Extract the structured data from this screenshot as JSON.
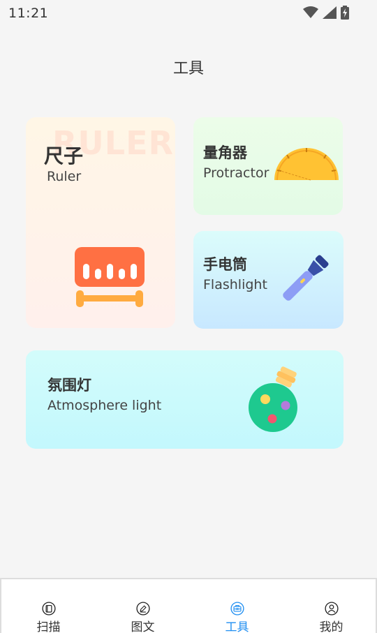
{
  "status_bar": {
    "time": "11:21",
    "icons": [
      "wifi-icon",
      "signal-icon",
      "battery-charging-icon"
    ]
  },
  "header": {
    "title": "工具"
  },
  "tools": {
    "ruler": {
      "title": "尺子",
      "subtitle": "Ruler",
      "watermark": "RULER"
    },
    "protractor": {
      "title": "量角器",
      "subtitle": "Protractor"
    },
    "flashlight": {
      "title": "手电筒",
      "subtitle": "Flashlight"
    },
    "atmosphere": {
      "title": "氛围灯",
      "subtitle": "Atmosphere light"
    }
  },
  "tab_bar": {
    "active": "tools",
    "tabs": [
      {
        "label": "扫描",
        "icon": "scan-icon"
      },
      {
        "label": "图文",
        "icon": "edit-icon"
      },
      {
        "label": "工具",
        "icon": "toolbox-icon"
      },
      {
        "label": "我的",
        "icon": "profile-icon"
      }
    ]
  },
  "colors": {
    "accent": "#1f8ef1",
    "ruler_orange": "#ff7043",
    "ruler_bar": "#ffab40",
    "protractor": "#ffc233"
  }
}
